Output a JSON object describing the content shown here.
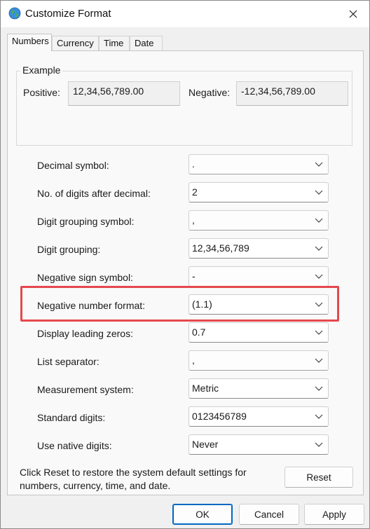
{
  "window": {
    "title": "Customize Format"
  },
  "tabs": [
    {
      "label": "Numbers",
      "active": true
    },
    {
      "label": "Currency",
      "active": false
    },
    {
      "label": "Time",
      "active": false
    },
    {
      "label": "Date",
      "active": false
    }
  ],
  "example": {
    "legend": "Example",
    "positive_label": "Positive:",
    "positive_value": "12,34,56,789.00",
    "negative_label": "Negative:",
    "negative_value": "-12,34,56,789.00"
  },
  "fields": [
    {
      "label": "Decimal symbol:",
      "value": "."
    },
    {
      "label": "No. of digits after decimal:",
      "value": "2"
    },
    {
      "label": "Digit grouping symbol:",
      "value": ","
    },
    {
      "label": "Digit grouping:",
      "value": "12,34,56,789"
    },
    {
      "label": "Negative sign symbol:",
      "value": "-"
    },
    {
      "label": "Negative number format:",
      "value": "(1.1)"
    },
    {
      "label": "Display leading zeros:",
      "value": "0.7"
    },
    {
      "label": "List separator:",
      "value": ","
    },
    {
      "label": "Measurement system:",
      "value": "Metric"
    },
    {
      "label": "Standard digits:",
      "value": "0123456789"
    },
    {
      "label": "Use native digits:",
      "value": "Never"
    }
  ],
  "footer": {
    "reset_note": "Click Reset to restore the system default settings for numbers, currency, time, and date.",
    "reset_label": "Reset",
    "ok_label": "OK",
    "cancel_label": "Cancel",
    "apply_label": "Apply"
  },
  "colors": {
    "highlight": "#e5484d",
    "primary_border": "#0067c0"
  }
}
